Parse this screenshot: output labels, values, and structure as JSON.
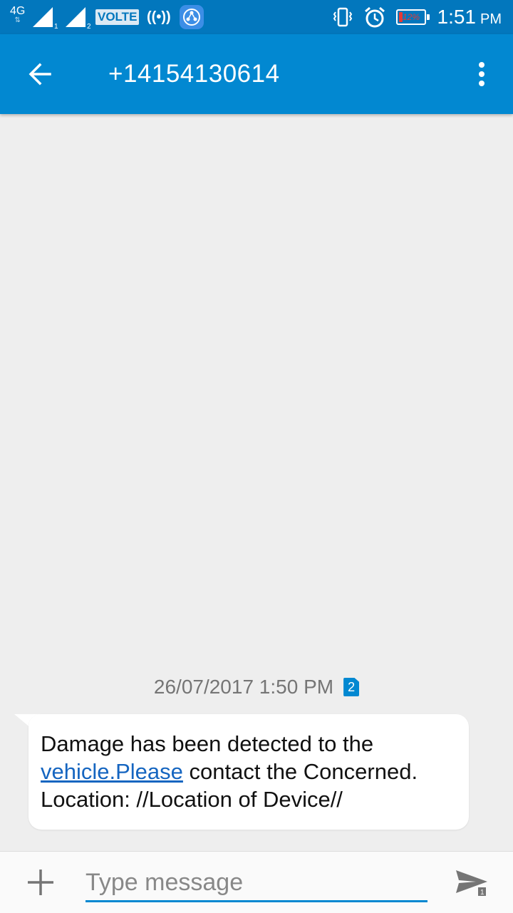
{
  "status_bar": {
    "network_type": "4G",
    "sim1_label": "1",
    "sim2_label": "2",
    "volte_label": "VOLTE",
    "hotspot_glyph": "((•))",
    "battery_percent_text": "12%",
    "battery_level": 0.12,
    "time": "1:51",
    "ampm": "PM"
  },
  "app_bar": {
    "title": "+14154130614",
    "back_icon": "arrow-back-icon",
    "menu_icon": "more-vert-icon"
  },
  "conversation": {
    "timestamp": "26/07/2017 1:50 PM",
    "sim_badge": "2",
    "message": {
      "text_before_link": "Damage has been detected to the ",
      "link_text": "vehicle.Please",
      "text_after_link": " contact the Concerned. Location: //Location of Device//"
    }
  },
  "composer": {
    "placeholder": "Type message",
    "value": "",
    "add_icon": "plus-icon",
    "send_icon": "send-icon",
    "send_sim_label": "1"
  },
  "colors": {
    "status_bar": "#0277bd",
    "app_bar": "#0288d1",
    "background": "#eeeeee",
    "link": "#1565c0",
    "battery_low": "#e53935"
  }
}
